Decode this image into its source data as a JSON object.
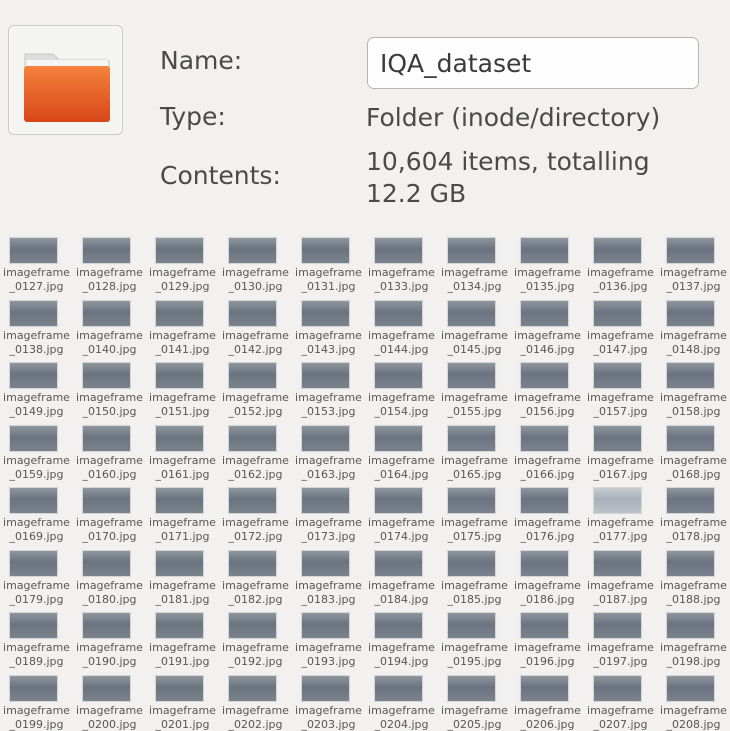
{
  "properties": {
    "name_label": "Name:",
    "name_value": "IQA_dataset",
    "type_label": "Type:",
    "type_value": "Folder (inode/directory)",
    "contents_label": "Contents:",
    "contents_value_line1": "10,604 items, totalling",
    "contents_value_line2": "12.2 GB",
    "folder_icon": "folder-icon",
    "folder_color": "#e9601f"
  },
  "files": [
    "imageframe_0127.jpg",
    "imageframe_0128.jpg",
    "imageframe_0129.jpg",
    "imageframe_0130.jpg",
    "imageframe_0131.jpg",
    "imageframe_0133.jpg",
    "imageframe_0134.jpg",
    "imageframe_0135.jpg",
    "imageframe_0136.jpg",
    "imageframe_0137.jpg",
    "imageframe_0138.jpg",
    "imageframe_0140.jpg",
    "imageframe_0141.jpg",
    "imageframe_0142.jpg",
    "imageframe_0143.jpg",
    "imageframe_0144.jpg",
    "imageframe_0145.jpg",
    "imageframe_0146.jpg",
    "imageframe_0147.jpg",
    "imageframe_0148.jpg",
    "imageframe_0149.jpg",
    "imageframe_0150.jpg",
    "imageframe_0151.jpg",
    "imageframe_0152.jpg",
    "imageframe_0153.jpg",
    "imageframe_0154.jpg",
    "imageframe_0155.jpg",
    "imageframe_0156.jpg",
    "imageframe_0157.jpg",
    "imageframe_0158.jpg",
    "imageframe_0159.jpg",
    "imageframe_0160.jpg",
    "imageframe_0161.jpg",
    "imageframe_0162.jpg",
    "imageframe_0163.jpg",
    "imageframe_0164.jpg",
    "imageframe_0165.jpg",
    "imageframe_0166.jpg",
    "imageframe_0167.jpg",
    "imageframe_0168.jpg",
    "imageframe_0169.jpg",
    "imageframe_0170.jpg",
    "imageframe_0171.jpg",
    "imageframe_0172.jpg",
    "imageframe_0173.jpg",
    "imageframe_0174.jpg",
    "imageframe_0175.jpg",
    "imageframe_0176.jpg",
    "imageframe_0177.jpg",
    "imageframe_0178.jpg",
    "imageframe_0179.jpg",
    "imageframe_0180.jpg",
    "imageframe_0181.jpg",
    "imageframe_0182.jpg",
    "imageframe_0183.jpg",
    "imageframe_0184.jpg",
    "imageframe_0185.jpg",
    "imageframe_0186.jpg",
    "imageframe_0187.jpg",
    "imageframe_0188.jpg",
    "imageframe_0189.jpg",
    "imageframe_0190.jpg",
    "imageframe_0191.jpg",
    "imageframe_0192.jpg",
    "imageframe_0193.jpg",
    "imageframe_0194.jpg",
    "imageframe_0195.jpg",
    "imageframe_0196.jpg",
    "imageframe_0197.jpg",
    "imageframe_0198.jpg",
    "imageframe_0199.jpg",
    "imageframe_0200.jpg",
    "imageframe_0201.jpg",
    "imageframe_0202.jpg",
    "imageframe_0203.jpg",
    "imageframe_0204.jpg",
    "imageframe_0205.jpg",
    "imageframe_0206.jpg",
    "imageframe_0207.jpg",
    "imageframe_0208.jpg"
  ],
  "light_thumbnail": "imageframe_0177.jpg"
}
